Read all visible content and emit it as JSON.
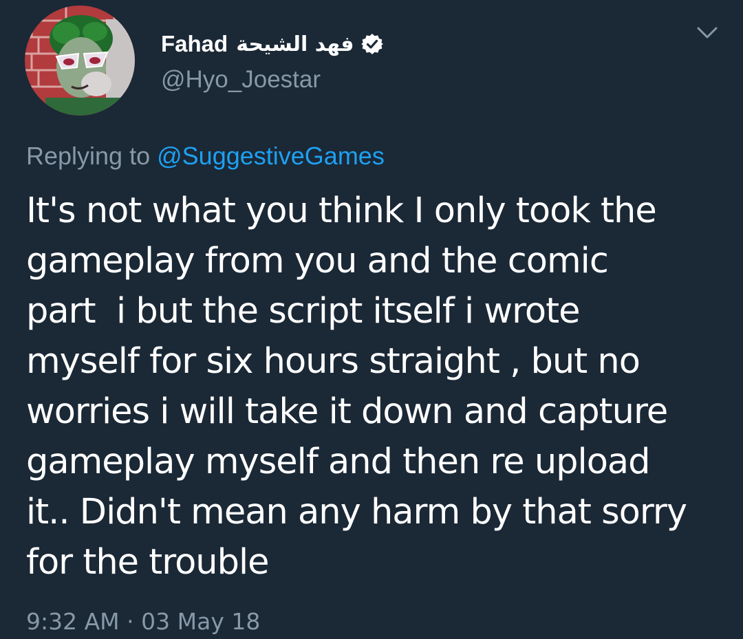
{
  "user": {
    "display_name": "Fahad",
    "arabic_name": "فهد الشيحة",
    "handle": "@Hyo_Joestar",
    "verified": true,
    "verified_icon": "verified-badge-icon",
    "avatar": "profile-photo"
  },
  "menu": {
    "icon": "chevron-down-icon"
  },
  "reply": {
    "label": "Replying to",
    "mention": "@SuggestiveGames"
  },
  "tweet": {
    "text": "It's not what you think I only took the\ngameplay from you and the comic\npart  i but the script itself i wrote\nmyself for six hours straight , but no\nworries i will take it down and capture\ngameplay myself and then re upload\nit.. Didn't mean any harm by that sorry\nfor the trouble",
    "time": "9:32 AM",
    "separator": "·",
    "date": "03 May 18"
  },
  "colors": {
    "background": "#1b2836",
    "text": "#ffffff",
    "muted": "#8899a6",
    "accent": "#1da1f2"
  }
}
